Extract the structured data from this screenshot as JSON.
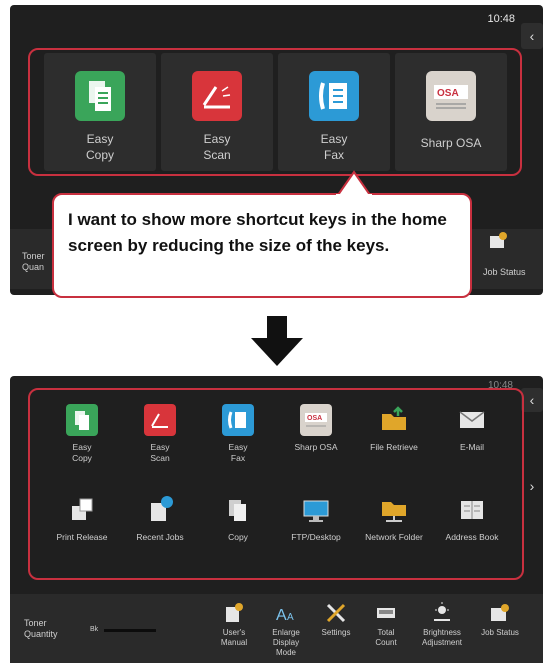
{
  "top_screen": {
    "clock": "10:48",
    "collapse_glyph": "‹",
    "keys": [
      {
        "label": "Easy\nCopy",
        "icon": "easy-copy-icon",
        "color": "#3aa55a"
      },
      {
        "label": "Easy\nScan",
        "icon": "easy-scan-icon",
        "color": "#d8353b"
      },
      {
        "label": "Easy\nFax",
        "icon": "easy-fax-icon",
        "color": "#2c9ad6"
      },
      {
        "label": "Sharp OSA",
        "icon": "sharp-osa-icon",
        "color": "#d9d3cc"
      }
    ],
    "bottom_left_text": "Toner\nQuan",
    "bottom_right_text": "Job Status"
  },
  "callout": {
    "text": "I want to show more shortcut keys in the home screen by reducing the size of the keys."
  },
  "arrow": "down-arrow",
  "bottom_screen": {
    "clock": "10:48",
    "collapse_glyph": "‹",
    "next_glyph": "›",
    "keys_row1": [
      {
        "label": "Easy\nCopy",
        "icon": "easy-copy-icon",
        "color": "#3aa55a"
      },
      {
        "label": "Easy\nScan",
        "icon": "easy-scan-icon",
        "color": "#d8353b"
      },
      {
        "label": "Easy\nFax",
        "icon": "easy-fax-icon",
        "color": "#2c9ad6"
      },
      {
        "label": "Sharp OSA",
        "icon": "sharp-osa-icon",
        "color": "#d9d3cc"
      },
      {
        "label": "File Retrieve",
        "icon": "file-retrieve-icon",
        "color": "#e0a62a"
      },
      {
        "label": "E-Mail",
        "icon": "email-icon",
        "color": "#e6e6e6"
      }
    ],
    "keys_row2": [
      {
        "label": "Print Release",
        "icon": "print-release-icon",
        "color": "#e6e6e6"
      },
      {
        "label": "Recent Jobs",
        "icon": "recent-jobs-icon",
        "color": "#e6e6e6"
      },
      {
        "label": "Copy",
        "icon": "copy-icon",
        "color": "#e6e6e6"
      },
      {
        "label": "FTP/Desktop",
        "icon": "ftp-desktop-icon",
        "color": "#2c9ad6"
      },
      {
        "label": "Network Folder",
        "icon": "network-folder-icon",
        "color": "#e0a62a"
      },
      {
        "label": "Address Book",
        "icon": "address-book-icon",
        "color": "#e6e6e6"
      }
    ],
    "toner_label": "Toner\nQuantity",
    "toner_value": "Bk",
    "bottom_items": [
      {
        "label": "User's\nManual",
        "icon": "users-manual-icon"
      },
      {
        "label": "Enlarge\nDisplay\nMode",
        "icon": "enlarge-display-icon"
      },
      {
        "label": "Settings",
        "icon": "settings-icon"
      },
      {
        "label": "Total\nCount",
        "icon": "total-count-icon"
      },
      {
        "label": "Brightness\nAdjustment",
        "icon": "brightness-icon"
      },
      {
        "label": "Job Status",
        "icon": "job-status-icon"
      }
    ]
  }
}
